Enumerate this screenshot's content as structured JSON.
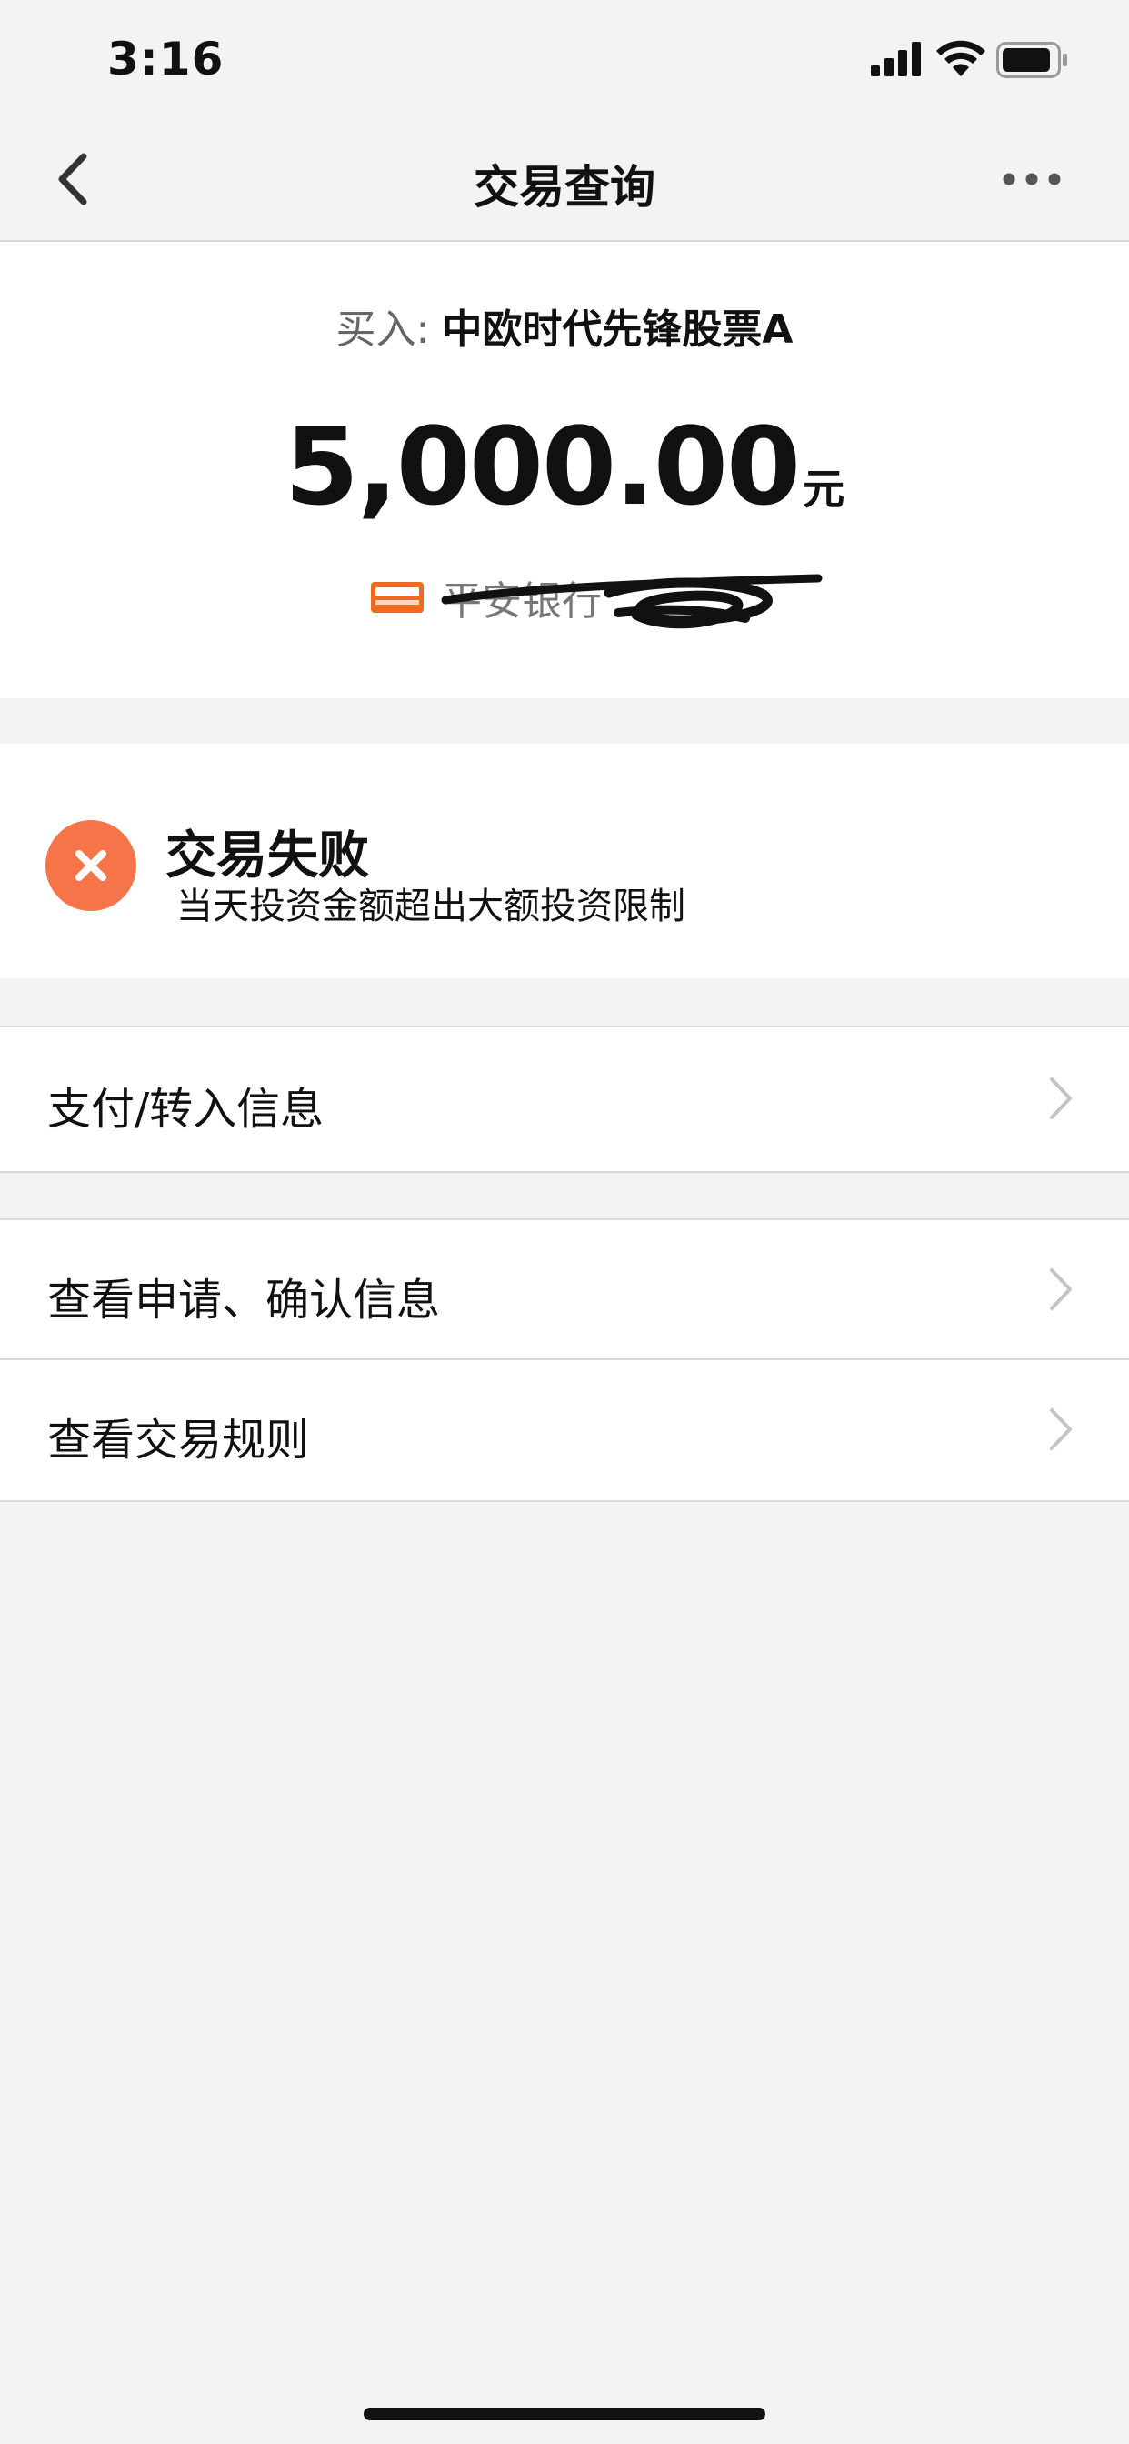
{
  "status_bar": {
    "time": "3:16"
  },
  "nav": {
    "title": "交易查询",
    "back_icon": "chevron-left-icon",
    "more_icon": "more-dots-icon"
  },
  "summary": {
    "buy_prefix": "买入:",
    "fund_name": "中欧时代先锋股票A",
    "amount": "5,000.00",
    "amount_unit": "元",
    "bank_name": "平安银行",
    "bank_logo_icon": "ping-an-bank-logo",
    "accent_color": "#ef6a1f"
  },
  "result": {
    "title": "交易失败",
    "description": "当天投资金额超出大额投资限制",
    "icon": "close-circle-icon",
    "icon_color": "#f5744a"
  },
  "rows": [
    {
      "label": "支付/转入信息"
    },
    {
      "label": "查看申请、确认信息"
    },
    {
      "label": "查看交易规则"
    }
  ]
}
